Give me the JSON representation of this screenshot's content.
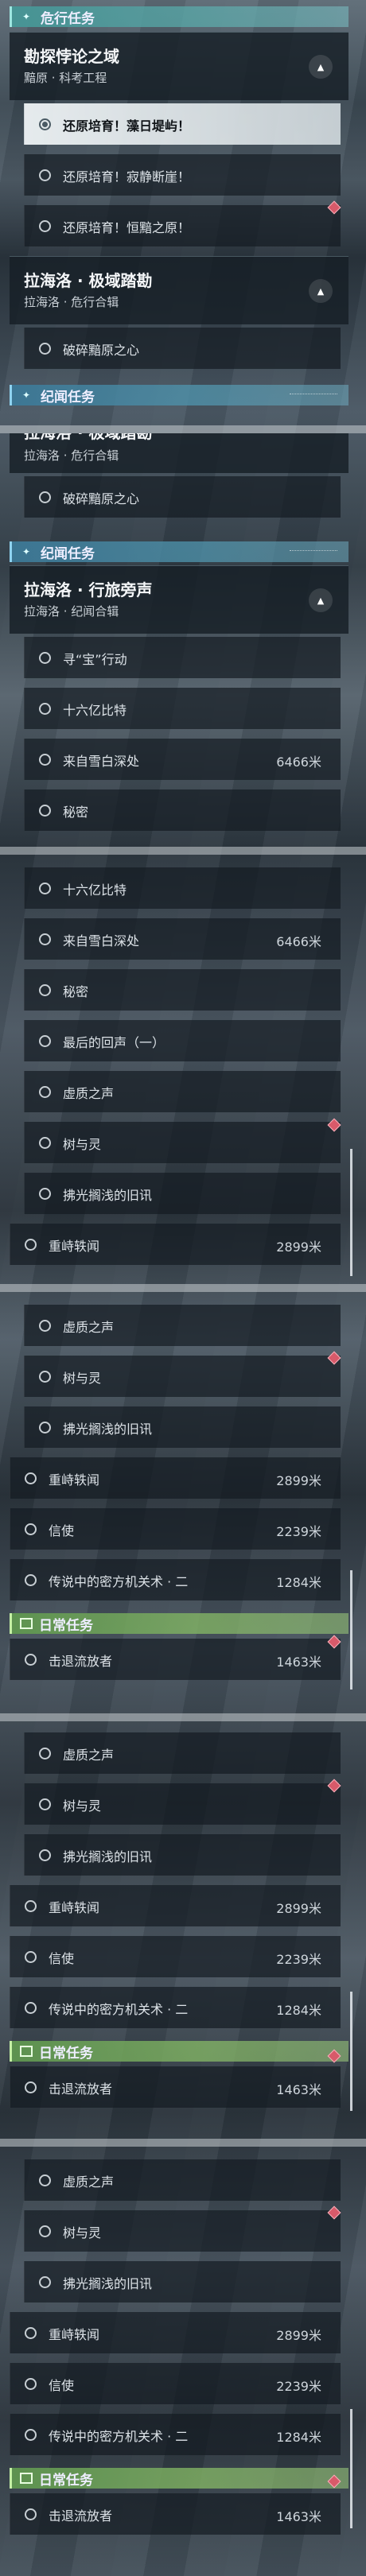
{
  "s1": {
    "cat": "危行任务",
    "grp1": {
      "title": "勘探悖论之域",
      "sub": "黯原 · 科考工程"
    },
    "items": [
      "还原培育！藻日堤屿！",
      "还原培育！寂静断崖！",
      "还原培育！恒黯之原！"
    ],
    "grp2": {
      "title": "拉海洛 · 极域踏勘",
      "sub": "拉海洛 · 危行合辑"
    },
    "item4": "破碎黯原之心",
    "cat2": "纪闻任务"
  },
  "s2": {
    "grp_title": "拉海洛 · 极域踏勘",
    "grp_sub": "拉海洛 · 危行合辑",
    "item": "破碎黯原之心",
    "cat": "纪闻任务",
    "grp2_title": "拉海洛 · 行旅旁声",
    "grp2_sub": "拉海洛 · 纪闻合辑",
    "items": [
      "寻“宝”行动",
      "十六亿比特",
      "来自雪白深处",
      "秘密"
    ],
    "dist": "6466米"
  },
  "s3": {
    "items": [
      "十六亿比特",
      "来自雪白深处",
      "秘密",
      "最后的回声（一）",
      "虚质之声",
      "树与灵",
      "拂光搁浅的旧讯",
      "重峙轶闻"
    ],
    "dist1": "6466米",
    "dist2": "2899米"
  },
  "s4": {
    "items": [
      "虚质之声",
      "树与灵",
      "拂光搁浅的旧讯",
      "重峙轶闻",
      "信使",
      "传说中的密方机关术 · 二"
    ],
    "dists": [
      "2899米",
      "2239米",
      "1284米"
    ],
    "cat": "日常任务",
    "daily": "击退流放者",
    "daily_dist": "1463米"
  },
  "s5": {
    "items": [
      "虚质之声",
      "树与灵",
      "拂光搁浅的旧讯",
      "重峙轶闻",
      "信使",
      "传说中的密方机关术 · 二"
    ],
    "dists": [
      "2899米",
      "2239米",
      "1284米"
    ],
    "cat": "日常任务",
    "daily": "击退流放者",
    "daily_dist": "1463米"
  },
  "s6": {
    "items": [
      "虚质之声",
      "树与灵",
      "拂光搁浅的旧讯",
      "重峙轶闻",
      "信使",
      "传说中的密方机关术 · 二"
    ],
    "dists": [
      "2899米",
      "2239米",
      "1284米"
    ],
    "cat": "日常任务",
    "daily": "击退流放者",
    "daily_dist": "1463米"
  },
  "icons": {
    "collapse": "chevron-up-icon",
    "radio": "radio-icon",
    "tracked": "diamond-marker-icon",
    "cat_star": "sparkle-icon",
    "cat_daily": "calendar-icon",
    "cat_danger": "hazard-icon"
  },
  "colors": {
    "selected_row": "#e8ecee",
    "marker": "#d85a6a",
    "cat_teal": "#4696a0",
    "cat_green": "#6f9e5c"
  }
}
